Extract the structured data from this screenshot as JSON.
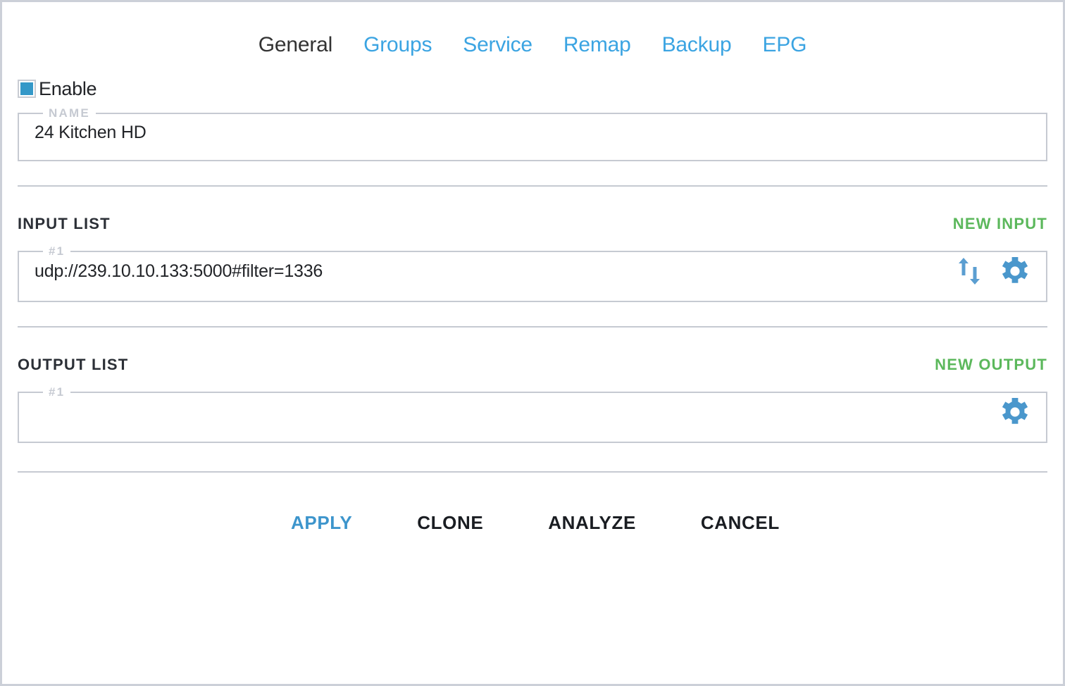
{
  "tabs": [
    {
      "label": "General",
      "active": true
    },
    {
      "label": "Groups",
      "active": false
    },
    {
      "label": "Service",
      "active": false
    },
    {
      "label": "Remap",
      "active": false
    },
    {
      "label": "Backup",
      "active": false
    },
    {
      "label": "EPG",
      "active": false
    }
  ],
  "enable": {
    "label": "Enable",
    "checked": true
  },
  "name_field": {
    "legend": "NAME",
    "value": "24 Kitchen HD"
  },
  "input_section": {
    "title": "INPUT LIST",
    "action_label": "NEW INPUT",
    "rows": [
      {
        "legend": "#1",
        "value": "udp://239.10.10.133:5000#filter=1336",
        "icons": [
          "sort-arrows-icon",
          "gear-icon"
        ]
      }
    ]
  },
  "output_section": {
    "title": "OUTPUT LIST",
    "action_label": "NEW OUTPUT",
    "rows": [
      {
        "legend": "#1",
        "value": "",
        "icons": [
          "gear-icon"
        ]
      }
    ]
  },
  "footer": {
    "apply_label": "APPLY",
    "clone_label": "CLONE",
    "analyze_label": "ANALYZE",
    "cancel_label": "CANCEL"
  },
  "colors": {
    "accent_blue": "#3498c8",
    "tab_blue": "#3ba4e2",
    "action_green": "#5cb85c",
    "border_gray": "#c6cad2",
    "text_dark": "#222428"
  }
}
